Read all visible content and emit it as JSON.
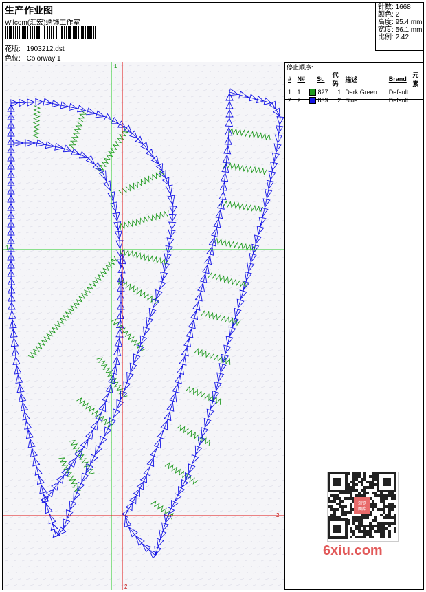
{
  "header": {
    "title": "生产作业图",
    "company": "Wilcom(汇宏)绣饰工作室",
    "design_label": "花版:",
    "design_value": "1903212.dst",
    "colorway_label": "色位:",
    "colorway_value": "Colorway 1"
  },
  "stats": [
    {
      "label": "针数:",
      "value": "1668"
    },
    {
      "label": "颜色:",
      "value": "2"
    },
    {
      "label": "高度:",
      "value": "95.4 mm"
    },
    {
      "label": "宽度:",
      "value": "56.1 mm"
    },
    {
      "label": "比例:",
      "value": "2.42"
    }
  ],
  "stop_panel": {
    "title": "停止顺序:",
    "columns": [
      "#",
      "N#",
      "St.",
      "代码",
      "描述",
      "Brand",
      "元素"
    ],
    "rows": [
      {
        "idx": "1.",
        "n": "1",
        "color": "#1f9a1f",
        "st": "827",
        "code": "1",
        "desc": "Dark Green",
        "brand": "Default"
      },
      {
        "idx": "2.",
        "n": "2",
        "color": "#1414e6",
        "st": "839",
        "code": "2",
        "desc": "Blue",
        "brand": "Default"
      }
    ]
  },
  "axis_labels": {
    "green_v": "1",
    "green_h": "1",
    "red_v": "2",
    "red_h": "2"
  },
  "colors": {
    "green": "#1f9a1f",
    "blue": "#1414e6",
    "red_line": "#e01010",
    "green_line": "#22cc22"
  },
  "watermark": "6xiu.com",
  "qr_badge": "浏览图库"
}
